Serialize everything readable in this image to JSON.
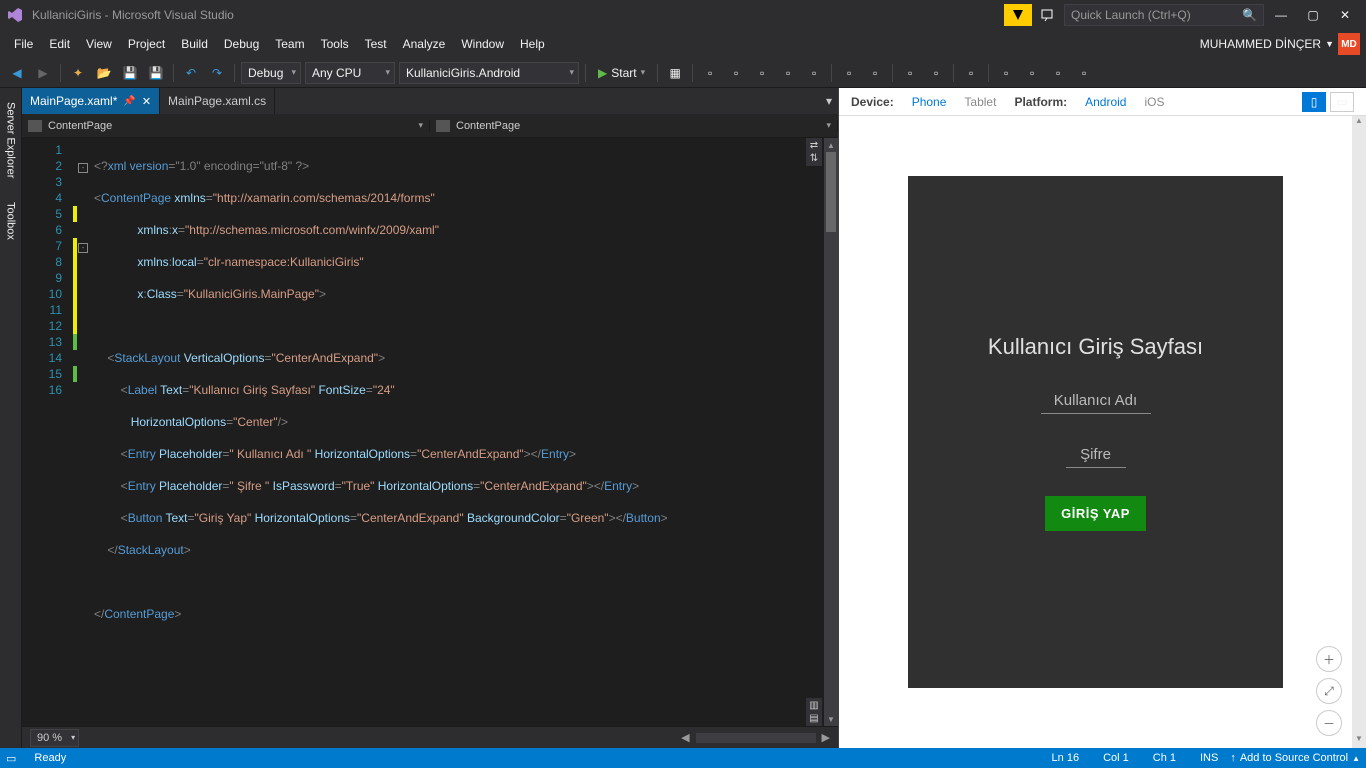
{
  "title": "KullaniciGiris - Microsoft Visual Studio",
  "quick_launch_placeholder": "Quick Launch (Ctrl+Q)",
  "menu": [
    "File",
    "Edit",
    "View",
    "Project",
    "Build",
    "Debug",
    "Team",
    "Tools",
    "Test",
    "Analyze",
    "Window",
    "Help"
  ],
  "user_name": "MUHAMMED DİNÇER",
  "user_initials": "MD",
  "toolbar": {
    "config": "Debug",
    "platform": "Any CPU",
    "project": "KullaniciGiris.Android",
    "start": "Start"
  },
  "side_tabs": [
    "Server Explorer",
    "Toolbox"
  ],
  "doc_tabs": [
    {
      "label": "MainPage.xaml*",
      "active": true
    },
    {
      "label": "MainPage.xaml.cs",
      "active": false
    }
  ],
  "nav_left": "ContentPage",
  "nav_right": "ContentPage",
  "code_lines": [
    1,
    2,
    3,
    4,
    5,
    6,
    7,
    8,
    9,
    10,
    11,
    12,
    13,
    14,
    15,
    16
  ],
  "zoom": "90 %",
  "preview": {
    "device_label": "Device:",
    "devices": [
      "Phone",
      "Tablet"
    ],
    "device_active": "Phone",
    "platform_label": "Platform:",
    "platforms": [
      "Android",
      "iOS"
    ],
    "platform_active": "Android",
    "login_title": "Kullanıcı Giriş Sayfası",
    "username_ph": "Kullanıcı Adı",
    "password_ph": "Şifre",
    "button": "GİRİŞ YAP"
  },
  "status": {
    "ready": "Ready",
    "ln": "Ln 16",
    "col": "Col 1",
    "ch": "Ch 1",
    "ins": "INS",
    "source_control": "Add to Source Control"
  },
  "code": {
    "l1_a": "<?",
    "l1_b": "xml version",
    "l1_c": "=\"1.0\" encoding=\"utf-8\" ",
    "l1_d": "?>",
    "l2_a": "<",
    "l2_b": "ContentPage ",
    "l2_c": "xmlns",
    "l2_d": "=",
    "l2_e": "\"http://xamarin.com/schemas/2014/forms\"",
    "l3_a": "xmlns",
    "l3_b": ":",
    "l3_c": "x",
    "l3_d": "=",
    "l3_e": "\"http://schemas.microsoft.com/winfx/2009/xaml\"",
    "l4_a": "xmlns",
    "l4_b": ":",
    "l4_c": "local",
    "l4_d": "=",
    "l4_e": "\"clr-namespace:KullaniciGiris\"",
    "l5_a": "x",
    "l5_b": ":",
    "l5_c": "Class",
    "l5_d": "=",
    "l5_e": "\"KullaniciGiris.MainPage\"",
    "l5_f": ">",
    "l7_a": "<",
    "l7_b": "StackLayout ",
    "l7_c": "VerticalOptions",
    "l7_d": "=",
    "l7_e": "\"CenterAndExpand\"",
    "l7_f": ">",
    "l8_a": "<",
    "l8_b": "Label ",
    "l8_c": "Text",
    "l8_d": "=",
    "l8_e": "\"Kullanıcı Giriş Sayfası\" ",
    "l8_f": "FontSize",
    "l8_g": "=",
    "l8_h": "\"24\"",
    "l9_a": "HorizontalOptions",
    "l9_b": "=",
    "l9_c": "\"Center\"",
    "l9_d": "/>",
    "l10_a": "<",
    "l10_b": "Entry ",
    "l10_c": "Placeholder",
    "l10_d": "=",
    "l10_e": "\" Kullanıcı Adı \" ",
    "l10_f": "HorizontalOptions",
    "l10_g": "=",
    "l10_h": "\"CenterAndExpand\"",
    "l10_i": "></",
    "l10_j": "Entry",
    "l10_k": ">",
    "l11_a": "<",
    "l11_b": "Entry ",
    "l11_c": "Placeholder",
    "l11_d": "=",
    "l11_e": "\" Şifre \" ",
    "l11_f": "IsPassword",
    "l11_g": "=",
    "l11_h": "\"True\" ",
    "l11_i": "HorizontalOptions",
    "l11_j": "=",
    "l11_k": "\"CenterAndExpand\"",
    "l11_l": "></",
    "l11_m": "Entry",
    "l11_n": ">",
    "l12_a": "<",
    "l12_b": "Button ",
    "l12_c": "Text",
    "l12_d": "=",
    "l12_e": "\"Giriş Yap\" ",
    "l12_f": "HorizontalOptions",
    "l12_g": "=",
    "l12_h": "\"CenterAndExpand\" ",
    "l12_i": "BackgroundColor",
    "l12_j": "=",
    "l12_k": "\"Green\"",
    "l12_l": "></",
    "l12_m": "Button",
    "l12_n": ">",
    "l13_a": "</",
    "l13_b": "StackLayout",
    "l13_c": ">",
    "l15_a": "</",
    "l15_b": "ContentPage",
    "l15_c": ">"
  }
}
